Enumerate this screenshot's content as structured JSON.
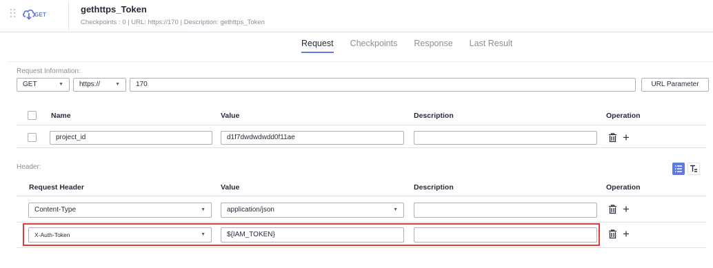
{
  "header": {
    "method": "GET",
    "title": "gethttps_Token",
    "subtitle": "Checkpoints : 0   |   URL: https://170   |   Description: gethttps_Token"
  },
  "tabs": [
    {
      "label": "Request",
      "active": true
    },
    {
      "label": "Checkpoints",
      "active": false
    },
    {
      "label": "Response",
      "active": false
    },
    {
      "label": "Last Result",
      "active": false
    }
  ],
  "request_info": {
    "label": "Request Information:",
    "method": "GET",
    "protocol": "https://",
    "url": "170",
    "url_param_button": "URL Parameter"
  },
  "params_table": {
    "headers": {
      "name": "Name",
      "value": "Value",
      "description": "Description",
      "operation": "Operation"
    },
    "rows": [
      {
        "name": "project_id",
        "value": "d1f7dwdwdwdd0f11ae",
        "description": ""
      }
    ]
  },
  "header_section": {
    "label": "Header:",
    "headers": {
      "name": "Request Header",
      "value": "Value",
      "description": "Description",
      "operation": "Operation"
    },
    "rows": [
      {
        "name": "Content-Type",
        "value": "application/json",
        "description": ""
      },
      {
        "name": "X-Auth-Token",
        "value": "${IAM_TOKEN}",
        "description": ""
      }
    ]
  },
  "colors": {
    "accent": "#5e7ce0",
    "highlight": "#e03b3b"
  },
  "icons": [
    "drag-handle-icon",
    "cloud-download-icon",
    "chevron-down-icon",
    "trash-icon",
    "plus-icon",
    "list-view-icon",
    "text-view-icon"
  ]
}
